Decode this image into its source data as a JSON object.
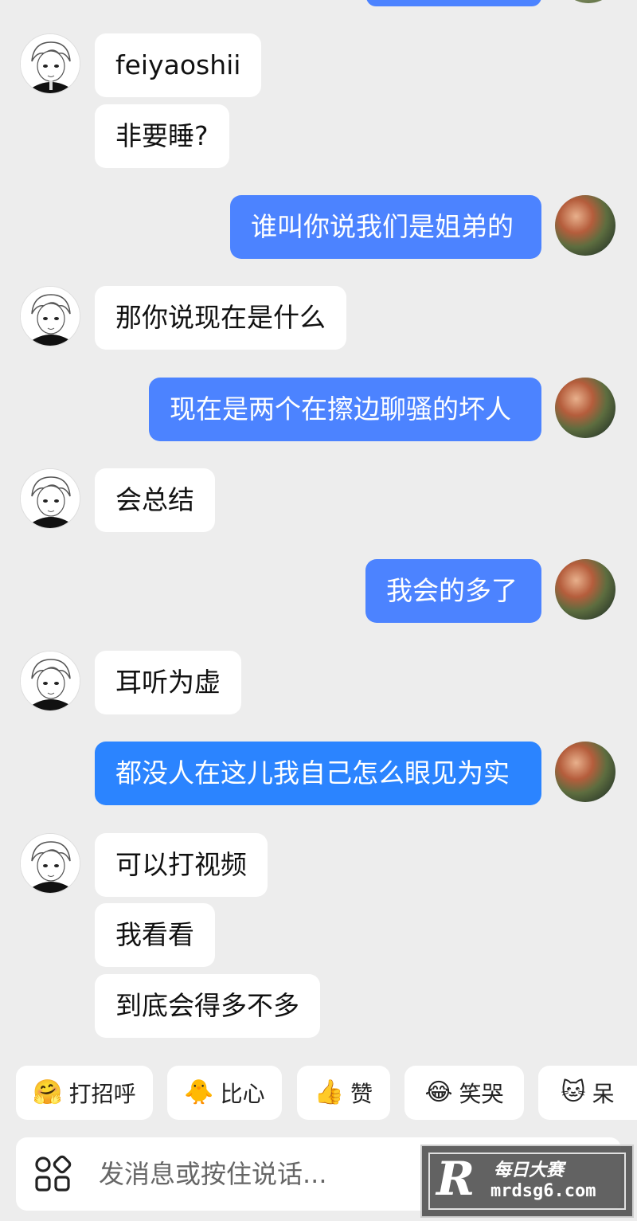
{
  "messages": [
    {
      "side": "in",
      "text": "feiyaoshii"
    },
    {
      "side": "in",
      "text": "非要睡?"
    },
    {
      "side": "out",
      "text": "谁叫你说我们是姐弟的"
    },
    {
      "side": "in",
      "text": "那你说现在是什么"
    },
    {
      "side": "out",
      "text": "现在是两个在擦边聊骚的坏人"
    },
    {
      "side": "in",
      "text": "会总结"
    },
    {
      "side": "out",
      "text": "我会的多了"
    },
    {
      "side": "in",
      "text": "耳听为虚"
    },
    {
      "side": "out",
      "text": "都没人在这儿我自己怎么眼见为实"
    },
    {
      "side": "in",
      "text": "可以打视频"
    },
    {
      "side": "in",
      "text": "我看看"
    },
    {
      "side": "in",
      "text": "到底会得多不多"
    }
  ],
  "quick_replies": [
    {
      "emoji": "🤗",
      "label": "打招呼"
    },
    {
      "emoji": "🐥",
      "label": "比心"
    },
    {
      "emoji": "👍",
      "label": "赞"
    },
    {
      "emoji": "😂",
      "label": "笑哭"
    },
    {
      "emoji": "🐱",
      "label": "呆"
    }
  ],
  "input": {
    "placeholder": "发消息或按住说话..."
  },
  "watermark": {
    "logo": "R",
    "title": "每日大赛",
    "url": "mrdsg6.com"
  },
  "colors": {
    "outgoing_bubble": "#4c83ff",
    "incoming_bubble": "#ffffff",
    "background": "#ededed"
  }
}
